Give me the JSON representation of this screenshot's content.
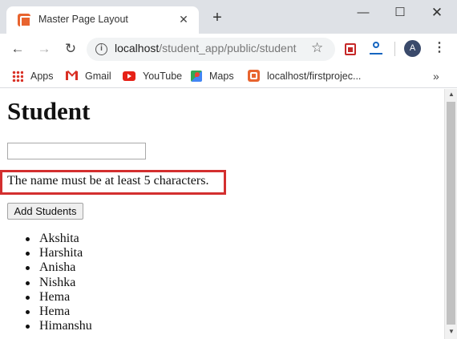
{
  "browser": {
    "tab": {
      "title": "Master Page Layout",
      "favicon": "xampp-icon",
      "close_glyph": "✕"
    },
    "new_tab_glyph": "+",
    "window_controls": {
      "minimize": "—",
      "maximize": "☐",
      "close": "✕"
    },
    "nav": {
      "back": "←",
      "forward": "→",
      "reload": "↻"
    },
    "address_bar": {
      "host": "localhost",
      "path": "/student_app/public/student",
      "star": "☆"
    },
    "profile_initial": "A",
    "menu_glyph": "⋮"
  },
  "bookmarks": {
    "items": [
      {
        "label": "Apps",
        "icon": "apps-grid-icon"
      },
      {
        "label": "Gmail",
        "icon": "gmail-icon"
      },
      {
        "label": "YouTube",
        "icon": "youtube-icon"
      },
      {
        "label": "Maps",
        "icon": "maps-icon"
      },
      {
        "label": "localhost/firstprojec...",
        "icon": "xampp-icon"
      }
    ],
    "overflow_glyph": "»"
  },
  "page": {
    "heading": "Student",
    "name_input": {
      "value": "",
      "placeholder": ""
    },
    "error_message": "The name must be at least 5 characters.",
    "submit_label": "Add Students",
    "students": [
      "Akshita",
      "Harshita",
      "Anisha",
      "Nishka",
      "Hema",
      "Hema",
      "Himanshu"
    ]
  },
  "scrollbar": {
    "up": "▲",
    "down": "▼"
  },
  "colors": {
    "error_border": "#d32f2f",
    "tab_strip": "#dee1e6",
    "omnibox": "#f1f3f4"
  }
}
